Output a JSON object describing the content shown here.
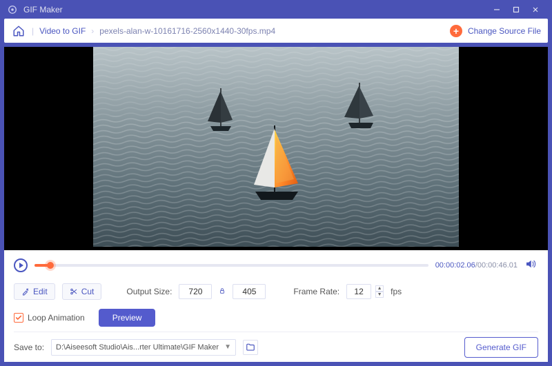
{
  "titlebar": {
    "app_name": "GIF Maker"
  },
  "toolbar": {
    "crumb1": "Video to GIF",
    "crumb2": "pexels-alan-w-10161716-2560x1440-30fps.mp4",
    "change_source": "Change Source File"
  },
  "playbar": {
    "current": "00:00:02.06",
    "total": "00:00:46.01"
  },
  "controls": {
    "edit": "Edit",
    "cut": "Cut",
    "output_size_label": "Output Size:",
    "width": "720",
    "height": "405",
    "frame_rate_label": "Frame Rate:",
    "frame_rate": "12",
    "fps": "fps",
    "loop_label": "Loop Animation",
    "preview": "Preview"
  },
  "save": {
    "label": "Save to:",
    "path": "D:\\Aiseesoft Studio\\Ais...rter Ultimate\\GIF Maker",
    "generate": "Generate GIF"
  }
}
